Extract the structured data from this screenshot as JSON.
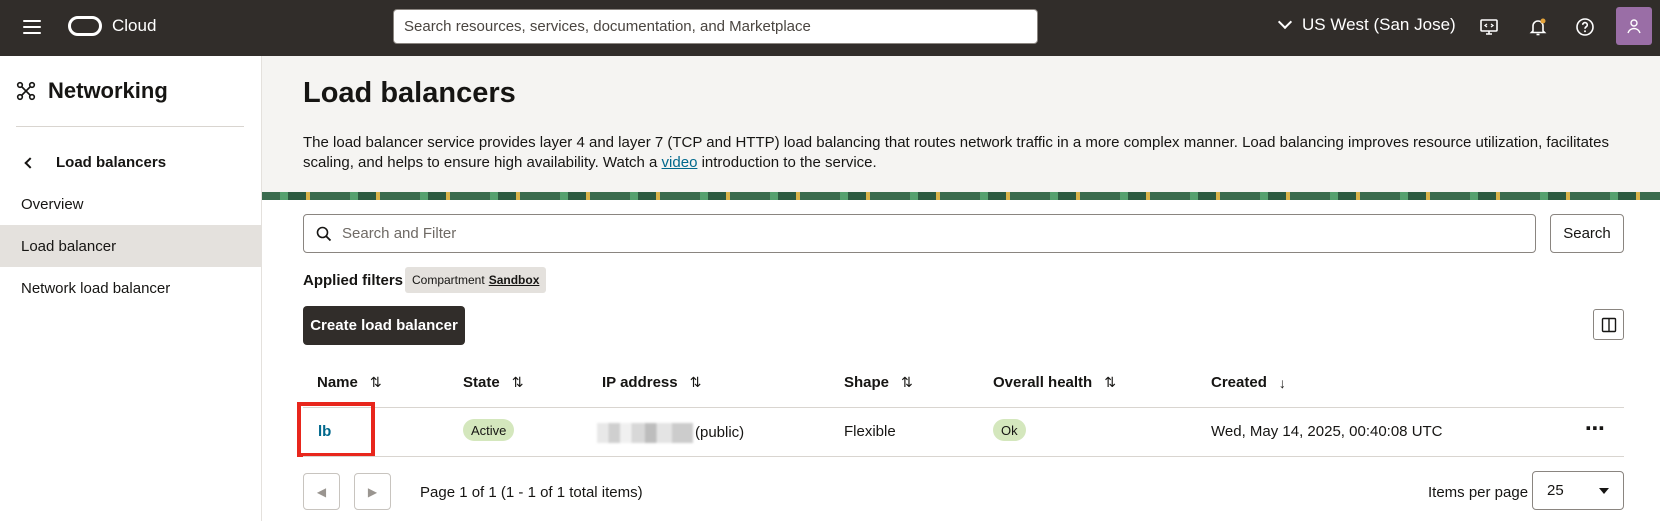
{
  "topbar": {
    "brand": "Cloud",
    "search_placeholder": "Search resources, services, documentation, and Marketplace",
    "region": "US West (San Jose)",
    "icons": [
      "menu-icon",
      "oracle-logo",
      "chevron-down-icon",
      "developer-tools-icon",
      "bell-icon",
      "help-icon",
      "user-icon"
    ]
  },
  "sidebar": {
    "title": "Networking",
    "back_label": "Load balancers",
    "items": [
      {
        "label": "Overview",
        "active": false
      },
      {
        "label": "Load balancer",
        "active": true
      },
      {
        "label": "Network load balancer",
        "active": false
      }
    ]
  },
  "page": {
    "title": "Load balancers",
    "desc_before": "The load balancer service provides layer 4 and layer 7 (TCP and HTTP) load balancing that routes network traffic in a more complex manner. Load balancing improves resource utilization, facilitates scaling, and helps to ensure high availability. Watch a ",
    "desc_link": "video",
    "desc_after": " introduction to the service."
  },
  "filters": {
    "placeholder": "Search and Filter",
    "search_button": "Search",
    "applied_label": "Applied filters",
    "chip_key": "Compartment",
    "chip_value": "Sandbox"
  },
  "actions": {
    "create_button": "Create load balancer"
  },
  "table": {
    "columns": [
      {
        "label": "Name",
        "sort": "⇅"
      },
      {
        "label": "State",
        "sort": "⇅"
      },
      {
        "label": "IP address",
        "sort": "⇅"
      },
      {
        "label": "Shape",
        "sort": "⇅"
      },
      {
        "label": "Overall health",
        "sort": "⇅"
      },
      {
        "label": "Created",
        "sort": "↓"
      }
    ],
    "rows": [
      {
        "name": "lb",
        "state": "Active",
        "ip_suffix": "(public)",
        "shape": "Flexible",
        "health": "Ok",
        "created": "Wed, May 14, 2025, 00:40:08 UTC"
      }
    ]
  },
  "pagination": {
    "text": "Page 1 of 1 (1 - 1 of 1 total items)",
    "items_per_page_label": "Items per page",
    "items_per_page": "25"
  },
  "colors": {
    "topbar": "#312d2a",
    "link": "#00688c",
    "badge_green": "#d4e7bd",
    "highlight": "#e8261c"
  }
}
